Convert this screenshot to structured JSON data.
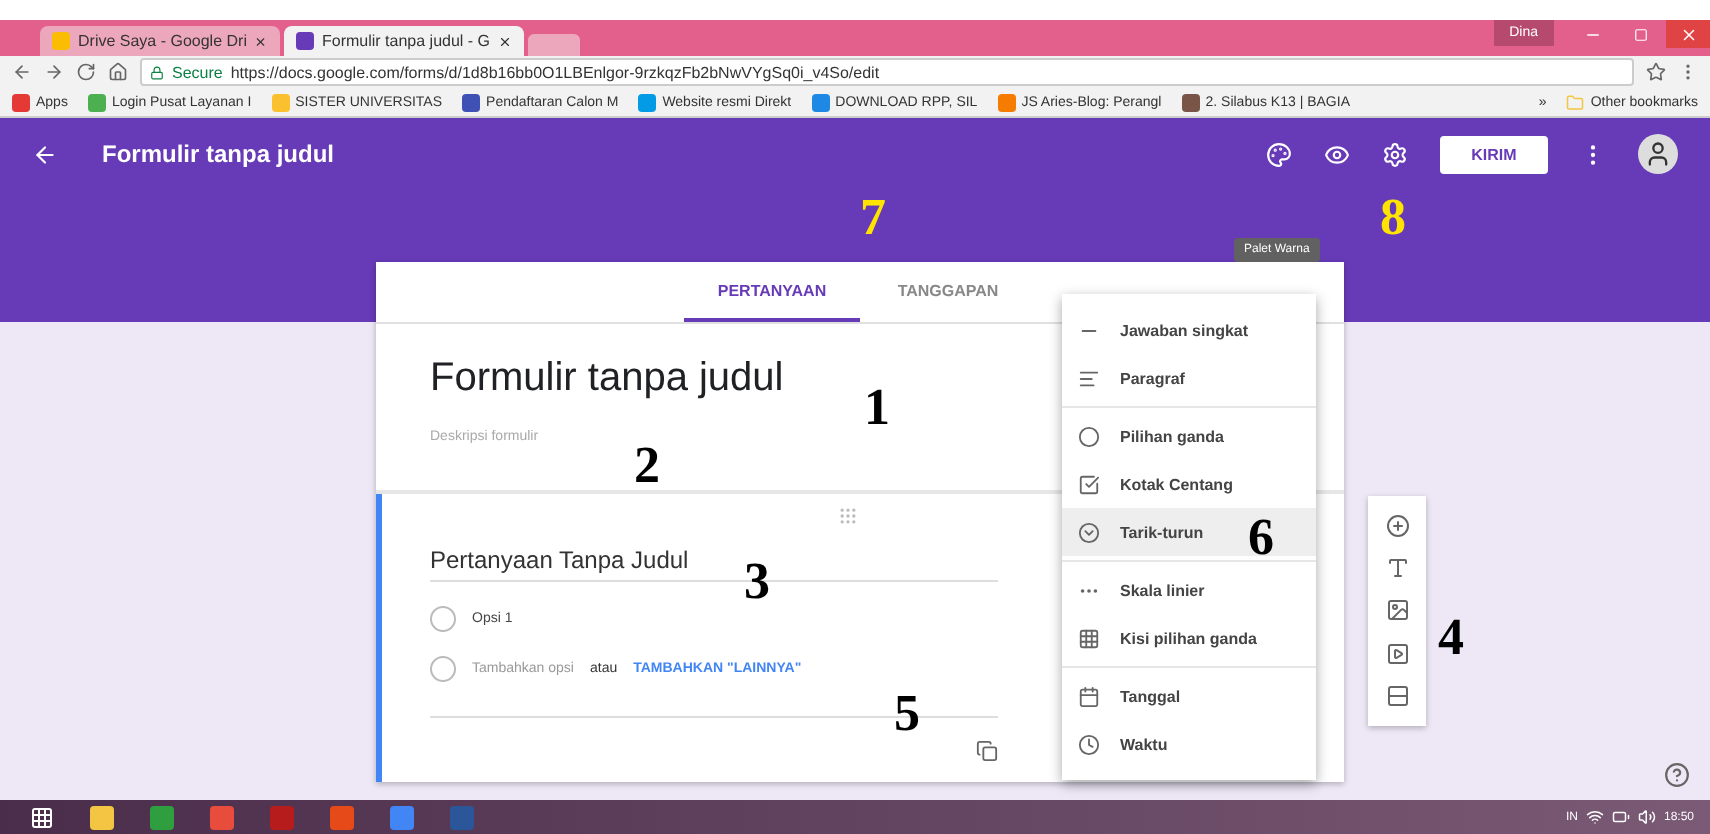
{
  "browser": {
    "tabs": [
      {
        "title": "Drive Saya - Google Dri",
        "selected": false
      },
      {
        "title": "Formulir tanpa judul - G",
        "selected": true
      }
    ],
    "profile": "Dina",
    "secure_label": "Secure",
    "url": "https://docs.google.com/forms/d/1d8b16bb0O1LBEnlgor-9rzkqzFb2bNwVYgSq0i_v4So/edit",
    "bookmarks": [
      "Apps",
      "Login Pusat Layanan I",
      "SISTER UNIVERSITAS",
      "Pendaftaran Calon M",
      "Website resmi Direkt",
      "DOWNLOAD RPP, SIL",
      "JS Aries-Blog: Perangl",
      "2. Silabus K13 | BAGIA"
    ],
    "more_bookmarks": "»",
    "other_bookmarks": "Other bookmarks"
  },
  "header": {
    "title": "Formulir tanpa judul",
    "send_button": "KIRIM",
    "tooltip": "Palet Warna"
  },
  "form_tabs": [
    {
      "label": "PERTANYAAN",
      "selected": true
    },
    {
      "label": "TANGGAPAN",
      "selected": false
    }
  ],
  "form": {
    "title": "Formulir tanpa judul",
    "description_placeholder": "Deskripsi formulir"
  },
  "question": {
    "title": "Pertanyaan Tanpa Judul",
    "option": "Opsi 1",
    "add_option": "Tambahkan opsi",
    "connector": "atau",
    "add_other": "TAMBAHKAN \"LAINNYA\""
  },
  "type_menu": [
    [
      {
        "kind": "short",
        "label": "Jawaban singkat",
        "selected": false
      },
      {
        "kind": "paragraph",
        "label": "Paragraf",
        "selected": false
      }
    ],
    [
      {
        "kind": "radio",
        "label": "Pilihan ganda",
        "selected": false
      },
      {
        "kind": "checkbox",
        "label": "Kotak Centang",
        "selected": false
      },
      {
        "kind": "dropdown",
        "label": "Tarik-turun",
        "selected": true
      }
    ],
    [
      {
        "kind": "scale",
        "label": "Skala linier",
        "selected": false
      },
      {
        "kind": "grid",
        "label": "Kisi pilihan ganda",
        "selected": false
      }
    ],
    [
      {
        "kind": "date",
        "label": "Tanggal",
        "selected": false
      },
      {
        "kind": "time",
        "label": "Waktu",
        "selected": false
      }
    ]
  ],
  "annotations": [
    {
      "label": "1",
      "color": "#000000"
    },
    {
      "label": "2",
      "color": "#000000"
    },
    {
      "label": "3",
      "color": "#000000"
    },
    {
      "label": "4",
      "color": "#000000"
    },
    {
      "label": "5",
      "color": "#000000"
    },
    {
      "label": "6",
      "color": "#000000"
    },
    {
      "label": "7",
      "color": "#ffe400"
    },
    {
      "label": "8",
      "color": "#ffe400"
    }
  ],
  "taskbar": {
    "language": "IN",
    "time": "18:50"
  }
}
